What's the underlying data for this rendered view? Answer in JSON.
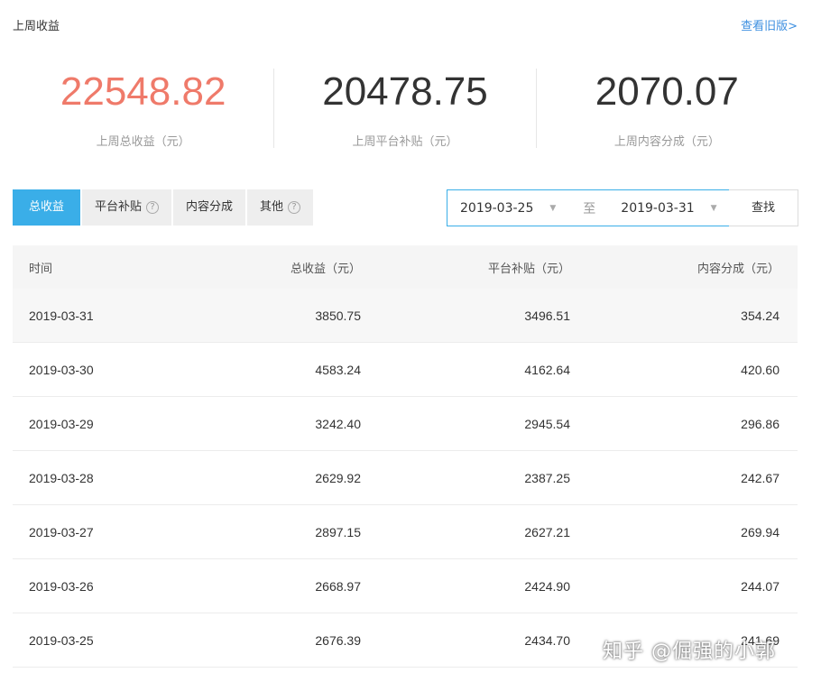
{
  "header": {
    "title": "上周收益",
    "old_version_link": "查看旧版>"
  },
  "summary": [
    {
      "value": "22548.82",
      "label": "上周总收益（元）"
    },
    {
      "value": "20478.75",
      "label": "上周平台补贴（元）"
    },
    {
      "value": "2070.07",
      "label": "上周内容分成（元）"
    }
  ],
  "tabs": [
    {
      "label": "总收益",
      "active": true,
      "help": false
    },
    {
      "label": "平台补贴",
      "active": false,
      "help": true
    },
    {
      "label": "内容分成",
      "active": false,
      "help": false
    },
    {
      "label": "其他",
      "active": false,
      "help": true
    }
  ],
  "date_range": {
    "start": "2019-03-25",
    "separator": "至",
    "end": "2019-03-31",
    "search_label": "查找"
  },
  "table": {
    "headers": [
      "时间",
      "总收益（元）",
      "平台补贴（元）",
      "内容分成（元）"
    ],
    "rows": [
      [
        "2019-03-31",
        "3850.75",
        "3496.51",
        "354.24"
      ],
      [
        "2019-03-30",
        "4583.24",
        "4162.64",
        "420.60"
      ],
      [
        "2019-03-29",
        "3242.40",
        "2945.54",
        "296.86"
      ],
      [
        "2019-03-28",
        "2629.92",
        "2387.25",
        "242.67"
      ],
      [
        "2019-03-27",
        "2897.15",
        "2627.21",
        "269.94"
      ],
      [
        "2019-03-26",
        "2668.97",
        "2424.90",
        "244.07"
      ],
      [
        "2019-03-25",
        "2676.39",
        "2434.70",
        "241.69"
      ]
    ]
  },
  "watermark": "知乎 @倔强的小郭",
  "colors": {
    "accent": "#3aaee8",
    "total_highlight": "#ef7a6a",
    "link": "#3d8fe0"
  }
}
